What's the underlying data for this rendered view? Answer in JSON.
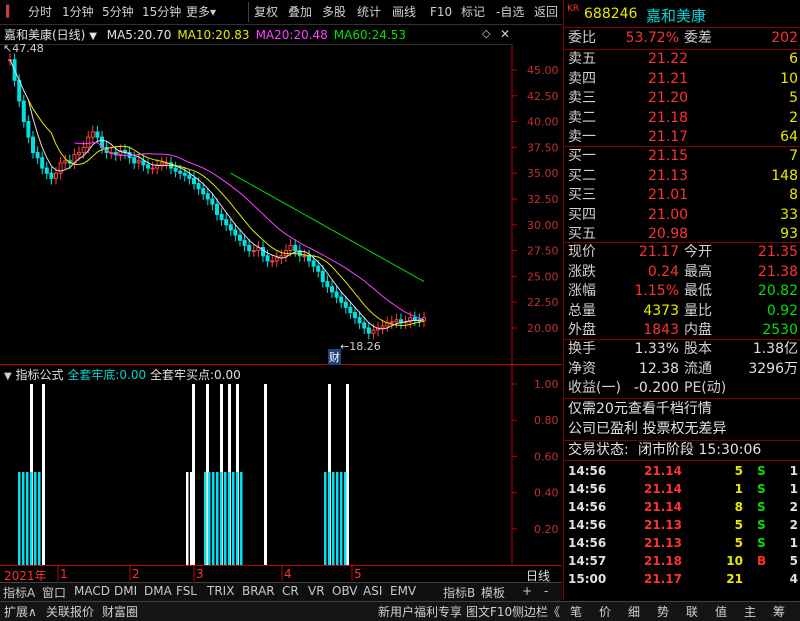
{
  "toolbar": {
    "items": [
      "分时",
      "1分钟",
      "5分钟",
      "15分钟",
      "更多",
      "复权",
      "叠加",
      "多股",
      "统计",
      "画线",
      "F10",
      "标记",
      "-自选",
      "返回"
    ],
    "more_arrow": "▾"
  },
  "chart": {
    "name": "嘉和美康(日线)",
    "ma": [
      {
        "label": "MA5:",
        "value": "20.70",
        "color": "#e0e0e0"
      },
      {
        "label": "MA10:",
        "value": "20.83",
        "color": "#e8e800"
      },
      {
        "label": "MA20:",
        "value": "20.48",
        "color": "#ff40ff"
      },
      {
        "label": "MA60:",
        "value": "24.53",
        "color": "#00e000"
      }
    ],
    "high_label": "47.48",
    "low_label": "18.26",
    "cai_label": "财",
    "y_ticks": [
      "45.00",
      "42.50",
      "40.00",
      "37.50",
      "35.00",
      "32.50",
      "30.00",
      "27.50",
      "25.00",
      "22.50",
      "20.00"
    ]
  },
  "indicator": {
    "prefix": "指标公式",
    "name1": "全套牢底:",
    "val1": "0.00",
    "name2": "全套牢买点:",
    "val2": "0.00",
    "y_ticks": [
      "1.00",
      "0.80",
      "0.60",
      "0.40",
      "0.20"
    ]
  },
  "xaxis": {
    "year": "2021年",
    "months": [
      "1",
      "2",
      "3",
      "4",
      "5"
    ],
    "period": "日线"
  },
  "tabs": [
    "指标A",
    "窗口",
    "MACD",
    "DMI",
    "DMA",
    "FSL",
    "TRIX",
    "BRAR",
    "CR",
    "VR",
    "OBV",
    "ASI",
    "EMV",
    "指标B",
    "模板",
    "+",
    "-"
  ],
  "statusbar": {
    "items": [
      "扩展∧",
      "关联报价",
      "财富圈"
    ],
    "right_items": [
      "新用户福利专享",
      "图文F10",
      "侧边栏《"
    ],
    "right_tabs": [
      "笔",
      "价",
      "细",
      "势",
      "联",
      "值",
      "主",
      "筹"
    ]
  },
  "quote": {
    "kr": "KR",
    "code": "688246",
    "name": "嘉和美康",
    "weibi_label": "委比",
    "weibi": "53.72%",
    "weicha_label": "委差",
    "weicha": "202",
    "sells": [
      {
        "label": "卖五",
        "price": "21.22",
        "vol": "6"
      },
      {
        "label": "卖四",
        "price": "21.21",
        "vol": "10"
      },
      {
        "label": "卖三",
        "price": "21.20",
        "vol": "5"
      },
      {
        "label": "卖二",
        "price": "21.18",
        "vol": "2"
      },
      {
        "label": "卖一",
        "price": "21.17",
        "vol": "64"
      }
    ],
    "buys": [
      {
        "label": "买一",
        "price": "21.15",
        "vol": "7"
      },
      {
        "label": "买二",
        "price": "21.13",
        "vol": "148"
      },
      {
        "label": "买三",
        "price": "21.01",
        "vol": "8"
      },
      {
        "label": "买四",
        "price": "21.00",
        "vol": "33"
      },
      {
        "label": "买五",
        "price": "20.98",
        "vol": "93"
      }
    ],
    "stats": [
      {
        "l1": "现价",
        "v1": "21.17",
        "c1": "#ff3232",
        "l2": "今开",
        "v2": "21.35",
        "c2": "#ff3232"
      },
      {
        "l1": "涨跌",
        "v1": "0.24",
        "c1": "#ff3232",
        "l2": "最高",
        "v2": "21.38",
        "c2": "#ff3232"
      },
      {
        "l1": "涨幅",
        "v1": "1.15%",
        "c1": "#ff3232",
        "l2": "最低",
        "v2": "20.82",
        "c2": "#00e000"
      },
      {
        "l1": "总量",
        "v1": "4373",
        "c1": "#e8e800",
        "l2": "量比",
        "v2": "0.92",
        "c2": "#00e000"
      },
      {
        "l1": "外盘",
        "v1": "1843",
        "c1": "#ff3232",
        "l2": "内盘",
        "v2": "2530",
        "c2": "#00e000"
      }
    ],
    "stats2": [
      {
        "l1": "换手",
        "v1": "1.33%",
        "l2": "股本",
        "v2": "1.38亿"
      },
      {
        "l1": "净资",
        "v1": "12.38",
        "l2": "流通",
        "v2": "3296万"
      },
      {
        "l1": "收益(一)",
        "v1": "-0.200",
        "l2": "PE(动)",
        "v2": ""
      }
    ],
    "promo1": "仅需20元查看千档行情",
    "promo2": "公司已盈利 投票权无差异",
    "status_label": "交易状态:",
    "status": "闭市阶段 15:30:06",
    "ticks": [
      {
        "t": "14:56",
        "p": "21.14",
        "v": "5",
        "d": "S",
        "n": "1"
      },
      {
        "t": "14:56",
        "p": "21.14",
        "v": "1",
        "d": "S",
        "n": "1"
      },
      {
        "t": "14:56",
        "p": "21.14",
        "v": "8",
        "d": "S",
        "n": "2"
      },
      {
        "t": "14:56",
        "p": "21.13",
        "v": "5",
        "d": "S",
        "n": "2"
      },
      {
        "t": "14:56",
        "p": "21.13",
        "v": "5",
        "d": "S",
        "n": "1"
      },
      {
        "t": "14:57",
        "p": "21.18",
        "v": "10",
        "d": "B",
        "n": "5"
      },
      {
        "t": "15:00",
        "p": "21.17",
        "v": "21",
        "d": "",
        "n": "4"
      }
    ]
  }
}
